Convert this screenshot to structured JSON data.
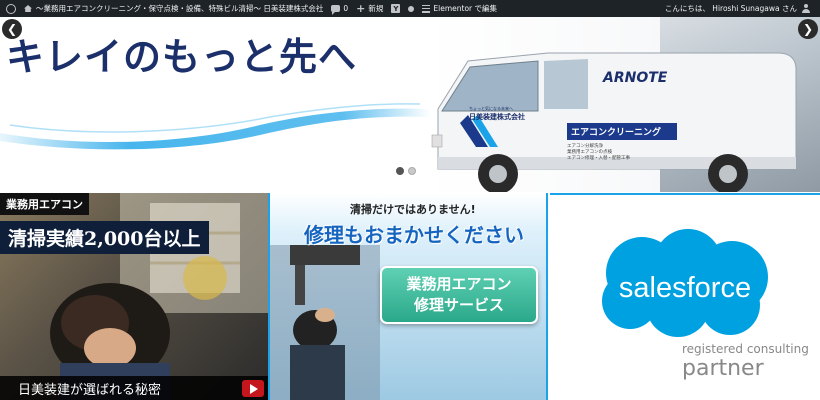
{
  "adminbar": {
    "site_name": "～業務用エアコンクリーニング・保守点検・設備、特殊ビル清掃～ 日美装建株式会社",
    "comments_count": "0",
    "new_label": "新規",
    "elementor_label": "Elementor で編集",
    "greeting": "こんにちは、 Hiroshi Sunagawa さん"
  },
  "hero": {
    "title": "キレイのもっと先へ",
    "van_logo": "ARNOTE",
    "van_company_small": "ちょっと気になる未来へ",
    "van_company": "日美装建株式会社",
    "van_service": "エアコンクリーニング",
    "van_lines": [
      "エアコン分解洗浄",
      "業務用エアコンの点検",
      "エアコン修理・入替・配管工事"
    ],
    "slides": 2,
    "active_slide": 1
  },
  "banners": {
    "b1": {
      "tag": "業務用エアコン",
      "headline": "清掃実績2,000台以上",
      "bottom": "日美装建が選ばれる秘密"
    },
    "b2": {
      "top": "清掃だけではありません!",
      "main": "修理もおまかせください",
      "box_line1": "業務用エアコン",
      "box_line2": "修理サービス"
    },
    "b3": {
      "brand": "salesforce",
      "sub": "registered consulting",
      "partner": "partner"
    }
  },
  "colors": {
    "navy": "#1b2f6b",
    "accent_blue": "#1aa3e8",
    "salesforce_blue": "#00a1e0",
    "admin_bar": "#1d2327"
  }
}
